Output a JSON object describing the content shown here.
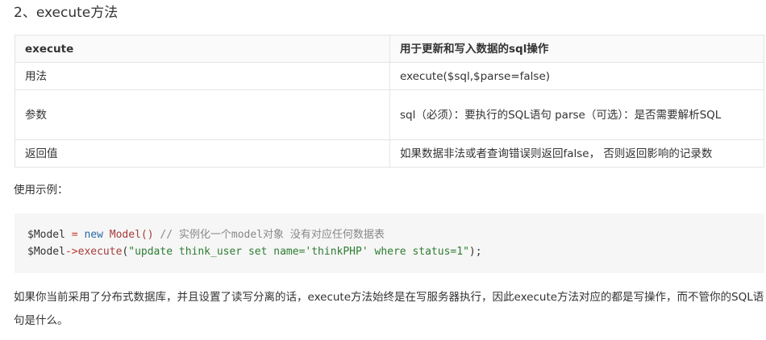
{
  "heading": "2、execute方法",
  "table": {
    "header": [
      "execute",
      "用于更新和写入数据的sql操作"
    ],
    "rows": [
      [
        "用法",
        "execute($sql,$parse=false)"
      ],
      [
        "参数",
        "sql（必须）：要执行的SQL语句 parse（可选）：是否需要解析SQL"
      ],
      [
        "返回值",
        "如果数据非法或者查询错误则返回false， 否则返回影响的记录数"
      ]
    ]
  },
  "example_label": "使用示例：",
  "code": {
    "line1": {
      "var": "$Model",
      "eq": " = ",
      "kw_new": "new",
      "cls": "Model",
      "parens": "()",
      "comment": " // 实例化一个model对象 没有对应任何数据表"
    },
    "line2": {
      "var": "$Model",
      "arrow": "->",
      "method": "execute",
      "open": "(",
      "str": "\"update think_user set name='thinkPHP' where status=1\"",
      "close": ");"
    }
  },
  "paragraph": "如果你当前采用了分布式数据库，并且设置了读写分离的话，execute方法始终是在写服务器执行，因此execute方法对应的都是写操作，而不管你的SQL语句是什么。",
  "colors": {
    "keyword": "#2a6aa6",
    "class_name": "#a63c3c",
    "string": "#2e7d32",
    "comment": "#888888",
    "code_bg": "#f6f6f6"
  }
}
